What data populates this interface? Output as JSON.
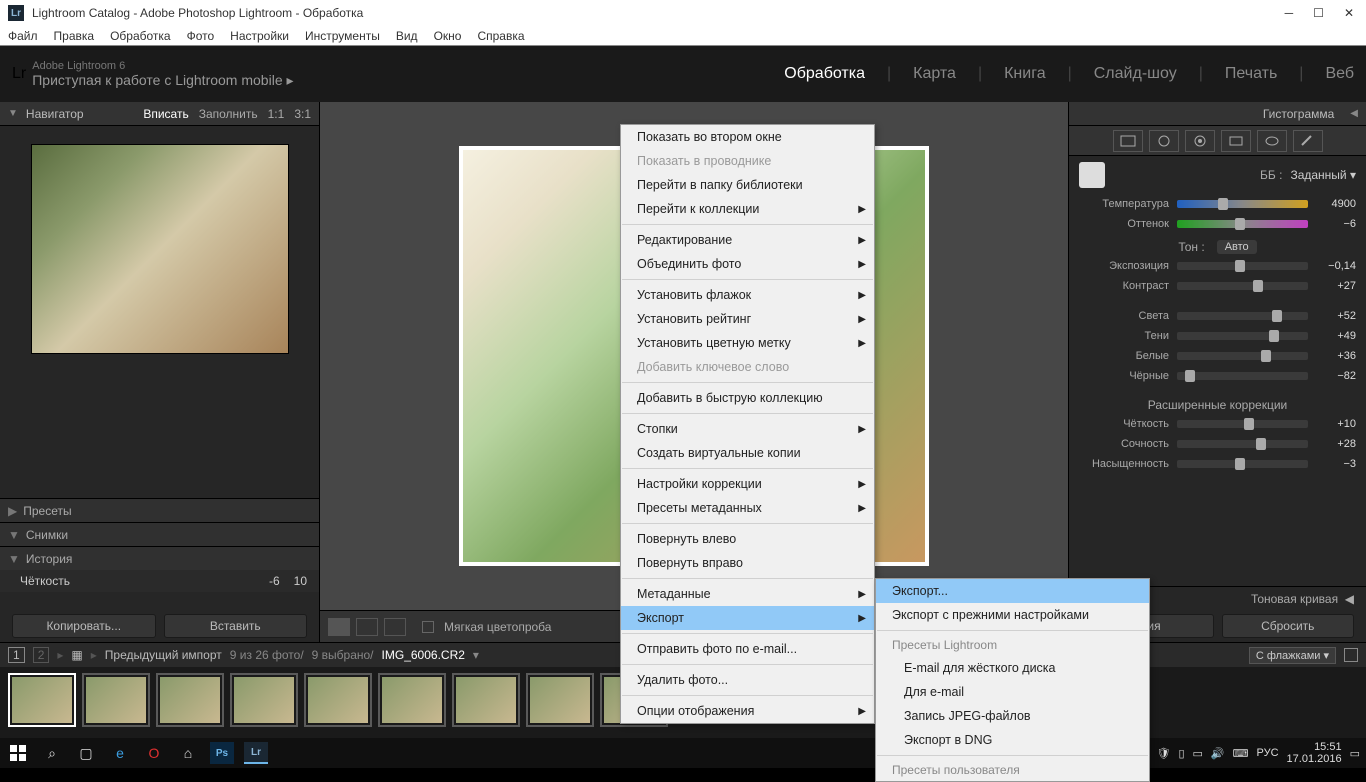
{
  "titlebar": {
    "title": "Lightroom Catalog - Adobe Photoshop Lightroom - Обработка",
    "lr": "Lr"
  },
  "menubar": [
    "Файл",
    "Правка",
    "Обработка",
    "Фото",
    "Настройки",
    "Инструменты",
    "Вид",
    "Окно",
    "Справка"
  ],
  "header": {
    "lr": "Lr",
    "line1": "Adobe Lightroom 6",
    "line2": "Приступая к работе с Lightroom mobile   ▸",
    "modules": [
      "Обработка",
      "Карта",
      "Книга",
      "Слайд-шоу",
      "Печать",
      "Веб"
    ],
    "active_module": "Обработка"
  },
  "left": {
    "navigator": "Навигатор",
    "nav_opts": [
      "Вписать",
      "Заполнить",
      "1:1",
      "3:1"
    ],
    "presets": "Пресеты",
    "snapshots": "Снимки",
    "history": "История",
    "history_item": "Чёткость",
    "history_vals": [
      "-6",
      "10"
    ],
    "copy": "Копировать...",
    "paste": "Вставить"
  },
  "center": {
    "softproof": "Мягкая цветопроба"
  },
  "right": {
    "histogram": "Гистограмма",
    "wb_label": "ББ :",
    "wb_value": "Заданный",
    "sliders": {
      "temperature": {
        "label": "Температура",
        "value": "4900",
        "pos": 35,
        "track": "temp"
      },
      "tint": {
        "label": "Оттенок",
        "value": "−6",
        "pos": 48,
        "track": "tint"
      },
      "tone_title": "Тон :",
      "auto": "Авто",
      "exposure": {
        "label": "Экспозиция",
        "value": "−0,14",
        "pos": 48,
        "track": "plain"
      },
      "contrast": {
        "label": "Контраст",
        "value": "+27",
        "pos": 62,
        "track": "plain"
      },
      "highlights": {
        "label": "Света",
        "value": "+52",
        "pos": 76,
        "track": "plain"
      },
      "shadows": {
        "label": "Тени",
        "value": "+49",
        "pos": 74,
        "track": "plain"
      },
      "whites": {
        "label": "Белые",
        "value": "+36",
        "pos": 68,
        "track": "plain"
      },
      "blacks": {
        "label": "Чёрные",
        "value": "−82",
        "pos": 10,
        "track": "plain"
      },
      "presence_title": "Расширенные коррекции",
      "clarity": {
        "label": "Чёткость",
        "value": "+10",
        "pos": 55,
        "track": "plain"
      },
      "vibrance": {
        "label": "Сочность",
        "value": "+28",
        "pos": 64,
        "track": "plain"
      },
      "saturation": {
        "label": "Насыщенность",
        "value": "−3",
        "pos": 48,
        "track": "plain"
      }
    },
    "tone_curve": "Тоновая кривая",
    "prev": "ация",
    "reset": "Сбросить"
  },
  "filmstrip": {
    "prev_import": "Предыдущий импорт",
    "count": "9 из 26 фото/",
    "sel": "9 выбрано/",
    "fname": "IMG_6006.CR2",
    "filter": "С флажками",
    "monitor_num": "1"
  },
  "context1_groups": [
    [
      {
        "t": "Показать во втором окне"
      },
      {
        "t": "Показать в проводнике",
        "d": true
      },
      {
        "t": "Перейти в папку библиотеки"
      },
      {
        "t": "Перейти к коллекции",
        "s": true
      }
    ],
    [
      {
        "t": "Редактирование",
        "s": true
      },
      {
        "t": "Объединить фото",
        "s": true
      }
    ],
    [
      {
        "t": "Установить флажок",
        "s": true
      },
      {
        "t": "Установить рейтинг",
        "s": true
      },
      {
        "t": "Установить цветную метку",
        "s": true
      },
      {
        "t": "Добавить ключевое слово",
        "d": true
      }
    ],
    [
      {
        "t": "Добавить в быструю коллекцию"
      }
    ],
    [
      {
        "t": "Стопки",
        "s": true
      },
      {
        "t": "Создать виртуальные копии"
      }
    ],
    [
      {
        "t": "Настройки коррекции",
        "s": true
      },
      {
        "t": "Пресеты метаданных",
        "s": true
      }
    ],
    [
      {
        "t": "Повернуть влево"
      },
      {
        "t": "Повернуть вправо"
      }
    ],
    [
      {
        "t": "Метаданные",
        "s": true
      },
      {
        "t": "Экспорт",
        "s": true,
        "hl": true
      }
    ],
    [
      {
        "t": "Отправить фото по e-mail..."
      }
    ],
    [
      {
        "t": "Удалить фото..."
      }
    ],
    [
      {
        "t": "Опции отображения",
        "s": true
      }
    ]
  ],
  "context2": {
    "items1": [
      {
        "t": "Экспорт...",
        "hl": true
      },
      {
        "t": "Экспорт с прежними настройками"
      }
    ],
    "title1": "Пресеты Lightroom",
    "presets": [
      "E-mail для жёсткого диска",
      "Для e-mail",
      "Запись JPEG-файлов",
      "Экспорт в DNG"
    ],
    "title2": "Пресеты пользователя"
  },
  "taskbar": {
    "lang": "РУС",
    "time": "15:51",
    "date": "17.01.2016"
  }
}
